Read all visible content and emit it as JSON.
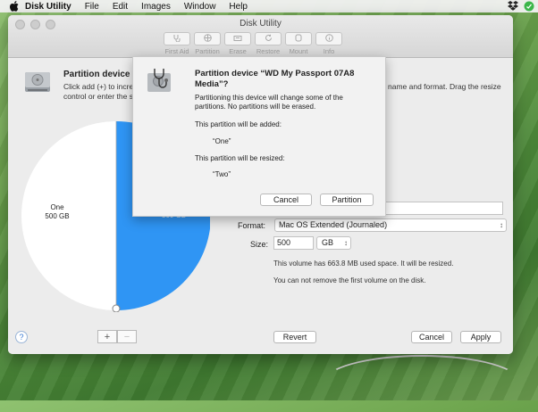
{
  "menubar": {
    "app": "Disk Utility",
    "items": [
      "File",
      "Edit",
      "Images",
      "Window",
      "Help"
    ]
  },
  "window": {
    "title": "Disk Utility",
    "toolbar": [
      "First Aid",
      "Partition",
      "Erase",
      "Restore",
      "Mount",
      "Info"
    ]
  },
  "panel": {
    "title": "Partition device \"W",
    "desc_left": "Click add (+) to increa control or enter the si",
    "desc_right": "name and format. Drag the resize"
  },
  "pie": {
    "one_name": "One",
    "one_size": "500 GB",
    "two_size": "500 GB"
  },
  "form": {
    "format_label": "Format:",
    "format_value": "Mac OS Extended (Journaled)",
    "size_label": "Size:",
    "size_value": "500",
    "size_unit": "GB",
    "info1": "This volume has 663.8 MB used space. It will be resized.",
    "info2": "You can not remove the first volume on the disk."
  },
  "buttons": {
    "add": "+",
    "remove": "−",
    "help": "?",
    "revert": "Revert",
    "cancel": "Cancel",
    "apply": "Apply"
  },
  "sheet": {
    "heading": "Partition device “WD My Passport 07A8 Media”?",
    "body": "Partitioning this device will change some of the partitions. No partitions will be erased.",
    "added_label": "This partition will be added:",
    "added_value": "“One”",
    "resized_label": "This partition will be resized:",
    "resized_value": "“Two”",
    "cancel": "Cancel",
    "partition": "Partition"
  }
}
